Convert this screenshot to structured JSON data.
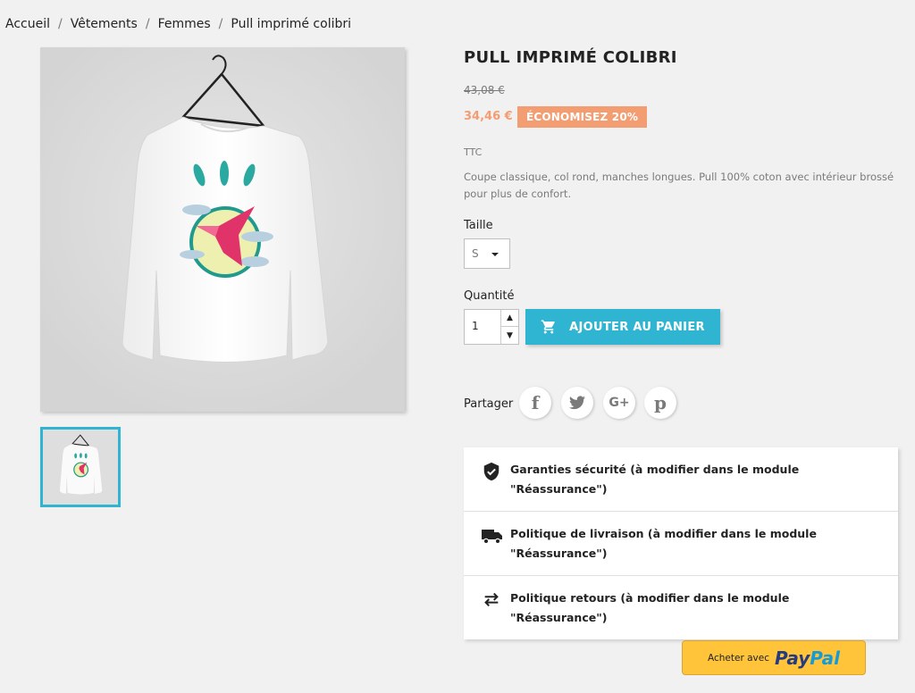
{
  "breadcrumb": {
    "items": [
      "Accueil",
      "Vêtements",
      "Femmes",
      "Pull imprimé colibri"
    ],
    "separator": "/"
  },
  "product": {
    "title": "PULL IMPRIMÉ COLIBRI",
    "old_price": "43,08 €",
    "price": "34,46 €",
    "discount": "ÉCONOMISEZ 20%",
    "tax_label": "TTC",
    "description": "Coupe classique, col rond, manches longues. Pull 100% coton avec intérieur brossé pour plus de confort."
  },
  "size": {
    "label": "Taille",
    "selected": "S"
  },
  "quantity": {
    "label": "Quantité",
    "value": "1",
    "up_icon": "chevron-up-icon",
    "down_icon": "chevron-down-icon"
  },
  "cart": {
    "button_label": "AJOUTER AU PANIER",
    "icon": "shopping-cart-icon"
  },
  "share": {
    "label": "Partager",
    "networks": [
      {
        "name": "facebook",
        "glyph": "f"
      },
      {
        "name": "twitter",
        "glyph": "t"
      },
      {
        "name": "google-plus",
        "glyph": "G+"
      },
      {
        "name": "pinterest",
        "glyph": "p"
      }
    ]
  },
  "reassurance": {
    "items": [
      {
        "icon": "shield-check-icon",
        "text": "Garanties sécurité (à modifier dans le module \"Réassurance\")"
      },
      {
        "icon": "truck-icon",
        "text": "Politique de livraison (à modifier dans le module \"Réassurance\")"
      },
      {
        "icon": "swap-arrows-icon",
        "text": "Politique retours (à modifier dans le module \"Réassurance\")"
      }
    ]
  },
  "paypal": {
    "prefix": "Acheter avec",
    "brand_part1": "Pay",
    "brand_part2": "Pal"
  },
  "colors": {
    "accent": "#2fb5d2",
    "discount": "#f39d72",
    "paypal": "#ffc439"
  }
}
